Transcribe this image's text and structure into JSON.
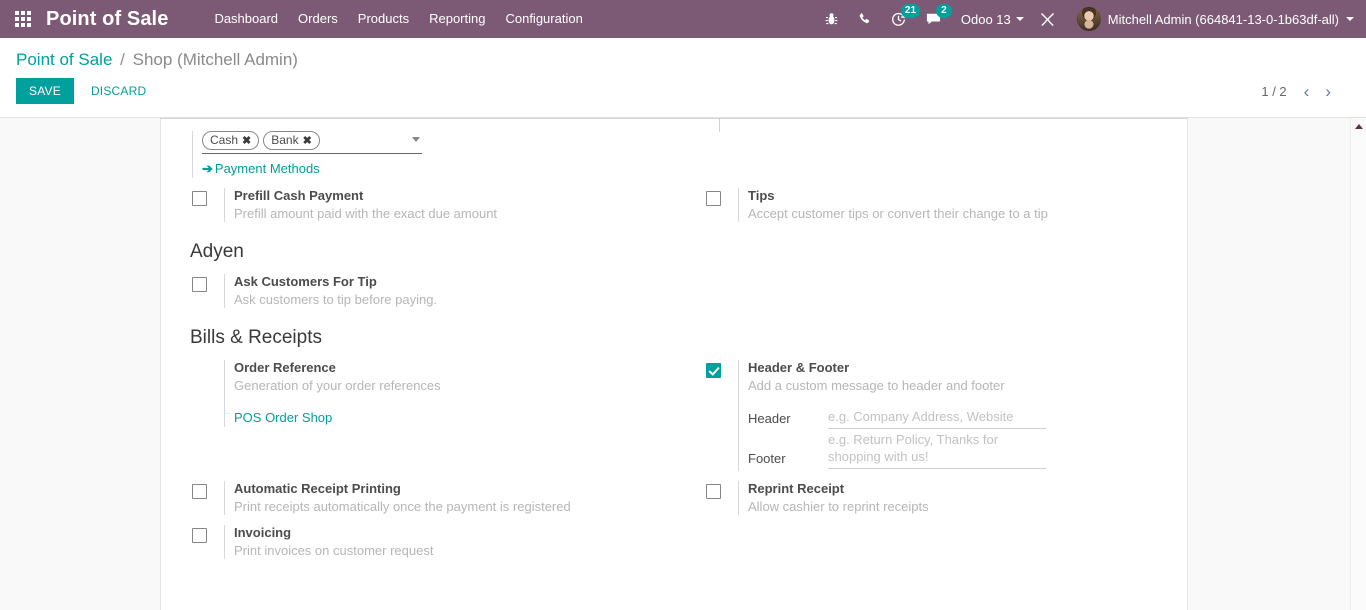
{
  "navbar": {
    "apps_icon": "apps-grid-icon",
    "brand": "Point of Sale",
    "menu": [
      {
        "label": "Dashboard"
      },
      {
        "label": "Orders"
      },
      {
        "label": "Products"
      },
      {
        "label": "Reporting"
      },
      {
        "label": "Configuration"
      }
    ],
    "icons": [
      {
        "name": "bug-icon"
      },
      {
        "name": "phone-icon"
      },
      {
        "name": "activity-clock-icon",
        "badge": "21"
      },
      {
        "name": "messages-icon",
        "badge": "2"
      }
    ],
    "database": "Odoo 13",
    "tools_icon": "wrench-screwdriver-icon",
    "user": "Mitchell Admin (664841-13-0-1b63df-all)",
    "accent": "#7c5a76"
  },
  "control_panel": {
    "breadcrumb_root": "Point of Sale",
    "breadcrumb_sep": "/",
    "breadcrumb_current": "Shop (Mitchell Admin)",
    "save_label": "SAVE",
    "discard_label": "DISCARD",
    "pager_value": "1 / 2",
    "pager_prev": "‹",
    "pager_next": "›",
    "accent": "#00a09d"
  },
  "settings": {
    "payment_methods": {
      "tags": [
        "Cash",
        "Bank"
      ],
      "tag_remove": "✖",
      "link_arrow": "➔",
      "link_label": "Payment Methods"
    },
    "prefill_cash": {
      "title": "Prefill Cash Payment",
      "desc": "Prefill amount paid with the exact due amount",
      "checked": false
    },
    "tips": {
      "title": "Tips",
      "desc": "Accept customer tips or convert their change to a tip",
      "checked": false
    },
    "adyen_section": "Adyen",
    "ask_tip": {
      "title": "Ask Customers For Tip",
      "desc": "Ask customers to tip before paying.",
      "checked": false
    },
    "bills_section": "Bills & Receipts",
    "order_reference": {
      "title": "Order Reference",
      "desc": "Generation of your order references",
      "link": "POS Order Shop"
    },
    "header_footer": {
      "title": "Header & Footer",
      "desc": "Add a custom message to header and footer",
      "checked": true,
      "header_label": "Header",
      "header_placeholder": "e.g. Company Address, Website",
      "footer_label": "Footer",
      "footer_placeholder": "e.g. Return Policy, Thanks for shopping with us!"
    },
    "auto_receipt": {
      "title": "Automatic Receipt Printing",
      "desc": "Print receipts automatically once the payment is registered",
      "checked": false
    },
    "reprint_receipt": {
      "title": "Reprint Receipt",
      "desc": "Allow cashier to reprint receipts",
      "checked": false
    },
    "invoicing": {
      "title": "Invoicing",
      "desc": "Print invoices on customer request",
      "checked": false
    }
  }
}
